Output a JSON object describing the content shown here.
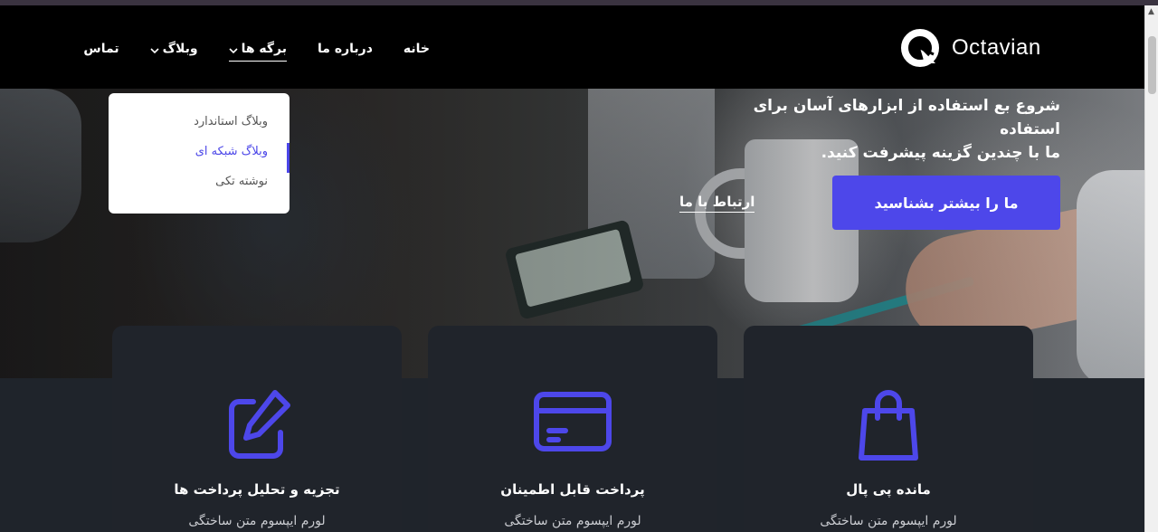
{
  "brand": {
    "name": "Octavian"
  },
  "nav": {
    "items": [
      {
        "label": "خانه",
        "has_dropdown": false,
        "active": false
      },
      {
        "label": "درباره ما",
        "has_dropdown": false,
        "active": false
      },
      {
        "label": "برگه ها",
        "has_dropdown": true,
        "active": true
      },
      {
        "label": "وبلاگ",
        "has_dropdown": true,
        "active": false
      },
      {
        "label": "تماس",
        "has_dropdown": false,
        "active": false
      }
    ]
  },
  "dropdown": {
    "items": [
      {
        "label": "وبلاگ استاندارد",
        "active": false
      },
      {
        "label": "وبلاگ شبکه ای",
        "active": true
      },
      {
        "label": "نوشته تکی",
        "active": false
      }
    ]
  },
  "hero": {
    "text_line1": "شروع بع استفاده از ابزارهای آسان برای استفاده",
    "text_line2": "ما با چندین گزینه پیشرفت کنید.",
    "primary_button": "ما را بیشتر بشناسید",
    "contact_link": "ارتباط با ما"
  },
  "cards": [
    {
      "title": "تجزیه و تحلیل پرداخت ها",
      "text": "لورم ایپسوم متن ساختگی",
      "icon": "edit-icon"
    },
    {
      "title": "پرداخت قابل اطمینان",
      "text": "لورم ایپسوم متن ساختگی",
      "icon": "credit-card-icon"
    },
    {
      "title": "مانده پی پال",
      "text": "لورم ایپسوم متن ساختگی",
      "icon": "shopping-bag-icon"
    }
  ],
  "colors": {
    "accent": "#4d47ea",
    "navbar": "#000000",
    "card_bg": "#20242b"
  }
}
